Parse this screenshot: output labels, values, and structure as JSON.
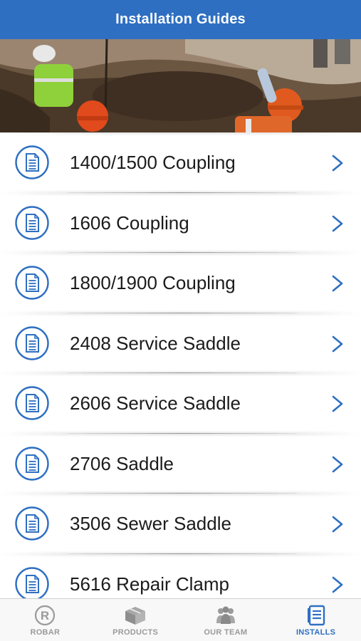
{
  "navbar": {
    "title": "Installation Guides"
  },
  "guides": [
    {
      "label": "1400/1500 Coupling"
    },
    {
      "label": "1606 Coupling"
    },
    {
      "label": "1800/1900 Coupling"
    },
    {
      "label": "2408 Service Saddle"
    },
    {
      "label": "2606 Service Saddle"
    },
    {
      "label": "2706 Saddle"
    },
    {
      "label": "3506 Sewer Saddle"
    },
    {
      "label": "5616 Repair Clamp"
    }
  ],
  "tabs": [
    {
      "label": "ROBAR",
      "icon": "robar-logo-icon",
      "active": false
    },
    {
      "label": "PRODUCTS",
      "icon": "box-icon",
      "active": false
    },
    {
      "label": "OUR TEAM",
      "icon": "team-icon",
      "active": false
    },
    {
      "label": "INSTALLS",
      "icon": "document-icon",
      "active": true
    }
  ],
  "colors": {
    "brand": "#2e6fc2",
    "inactive": "#9a9a9a",
    "text": "#1b1b1b"
  }
}
